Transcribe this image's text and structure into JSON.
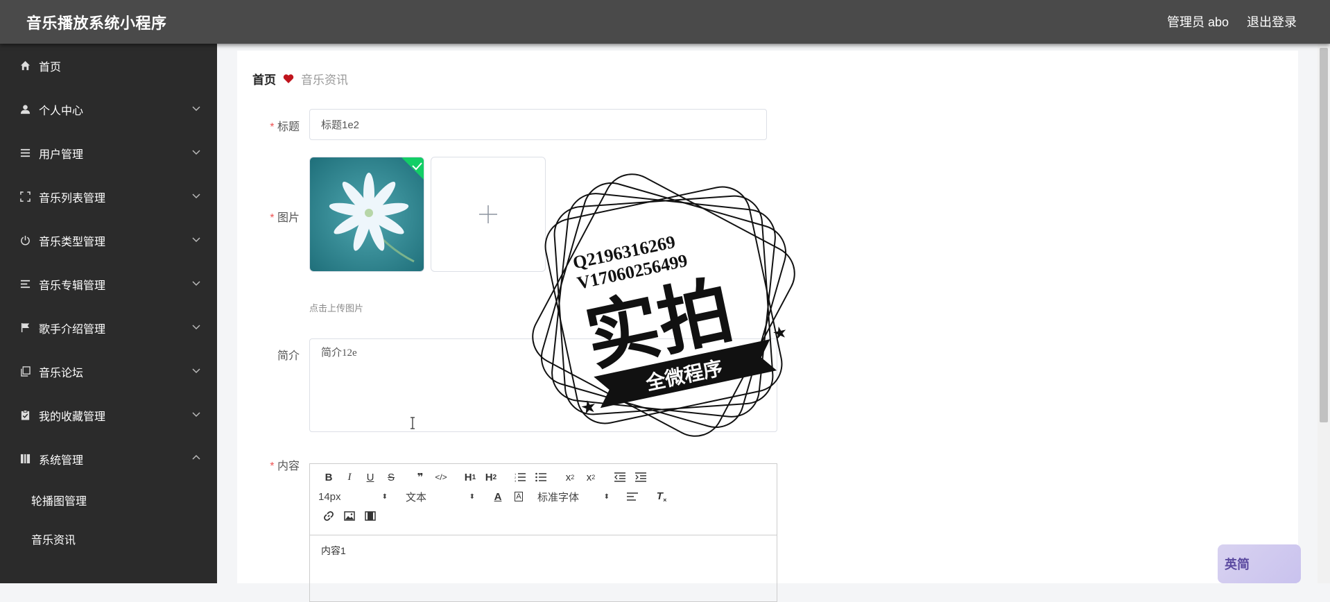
{
  "header": {
    "title": "音乐播放系统小程序",
    "user": "管理员 abo",
    "logout": "退出登录"
  },
  "sidebar": {
    "items": [
      {
        "label": "首页",
        "icon": "home-icon",
        "expandable": false
      },
      {
        "label": "个人中心",
        "icon": "user-icon",
        "expandable": true
      },
      {
        "label": "用户管理",
        "icon": "list-icon",
        "expandable": true
      },
      {
        "label": "音乐列表管理",
        "icon": "frame-icon",
        "expandable": true
      },
      {
        "label": "音乐类型管理",
        "icon": "power-icon",
        "expandable": true
      },
      {
        "label": "音乐专辑管理",
        "icon": "align-icon",
        "expandable": true
      },
      {
        "label": "歌手介绍管理",
        "icon": "flag-icon",
        "expandable": true
      },
      {
        "label": "音乐论坛",
        "icon": "copy-icon",
        "expandable": true
      },
      {
        "label": "我的收藏管理",
        "icon": "clipboard-check-icon",
        "expandable": true
      },
      {
        "label": "系统管理",
        "icon": "book-icon",
        "expandable": true,
        "expanded": true
      }
    ],
    "subitems": [
      {
        "label": "轮播图管理"
      },
      {
        "label": "音乐资讯"
      }
    ]
  },
  "breadcrumb": {
    "home": "首页",
    "current": "音乐资讯"
  },
  "form": {
    "title_label": "标题",
    "title_value": "标题1e2",
    "image_label": "图片",
    "upload_hint": "点击上传图片",
    "intro_label": "简介",
    "intro_value": "简介12e",
    "content_label": "内容",
    "content_value": "内容1",
    "required_mark": "*"
  },
  "editor": {
    "font_size": "14px",
    "header_style": "文本",
    "font_family": "标准字体",
    "buttons_row1": [
      "B",
      "I",
      "U",
      "S",
      "❞",
      "</>",
      "H1",
      "H2",
      "ol",
      "ul",
      "x₂",
      "x²",
      "outdent",
      "indent"
    ]
  },
  "stamp": {
    "line1": "Q2196316269",
    "line2": "V17060256499",
    "big": "实拍",
    "ribbon": "全微程序"
  },
  "badge": {
    "text": "英简"
  },
  "colors": {
    "topbar": "#4a4a4a",
    "sidebar": "#2b2b2b",
    "heart": "#c0141d",
    "required": "#e55555"
  }
}
